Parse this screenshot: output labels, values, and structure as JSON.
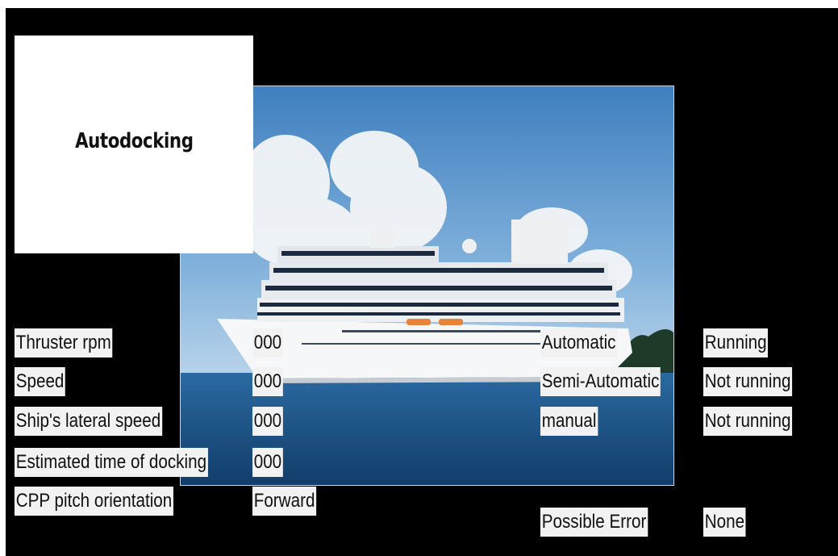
{
  "title": "Autodocking",
  "photo_icon": "cruise-ship-photo",
  "params": [
    {
      "label": "Thruster rpm",
      "value": "000"
    },
    {
      "label": "Speed",
      "value": "000"
    },
    {
      "label": "Ship's lateral speed",
      "value": "000"
    },
    {
      "label": "Estimated time of docking",
      "value": "000"
    },
    {
      "label": "CPP pitch orientation",
      "value": "Forward"
    }
  ],
  "modes": [
    {
      "label": "Automatic",
      "status": "Running"
    },
    {
      "label": "Semi-Automatic",
      "status": "Not running"
    },
    {
      "label": "manual",
      "status": "Not running"
    }
  ],
  "error": {
    "label": "Possible Error",
    "value": "None"
  },
  "colors": {
    "background": "#000000",
    "panel": "#ffffff",
    "label_bg": "#f2f2f2",
    "sky": "#4f8ec6",
    "sea": "#1f5a8c"
  }
}
